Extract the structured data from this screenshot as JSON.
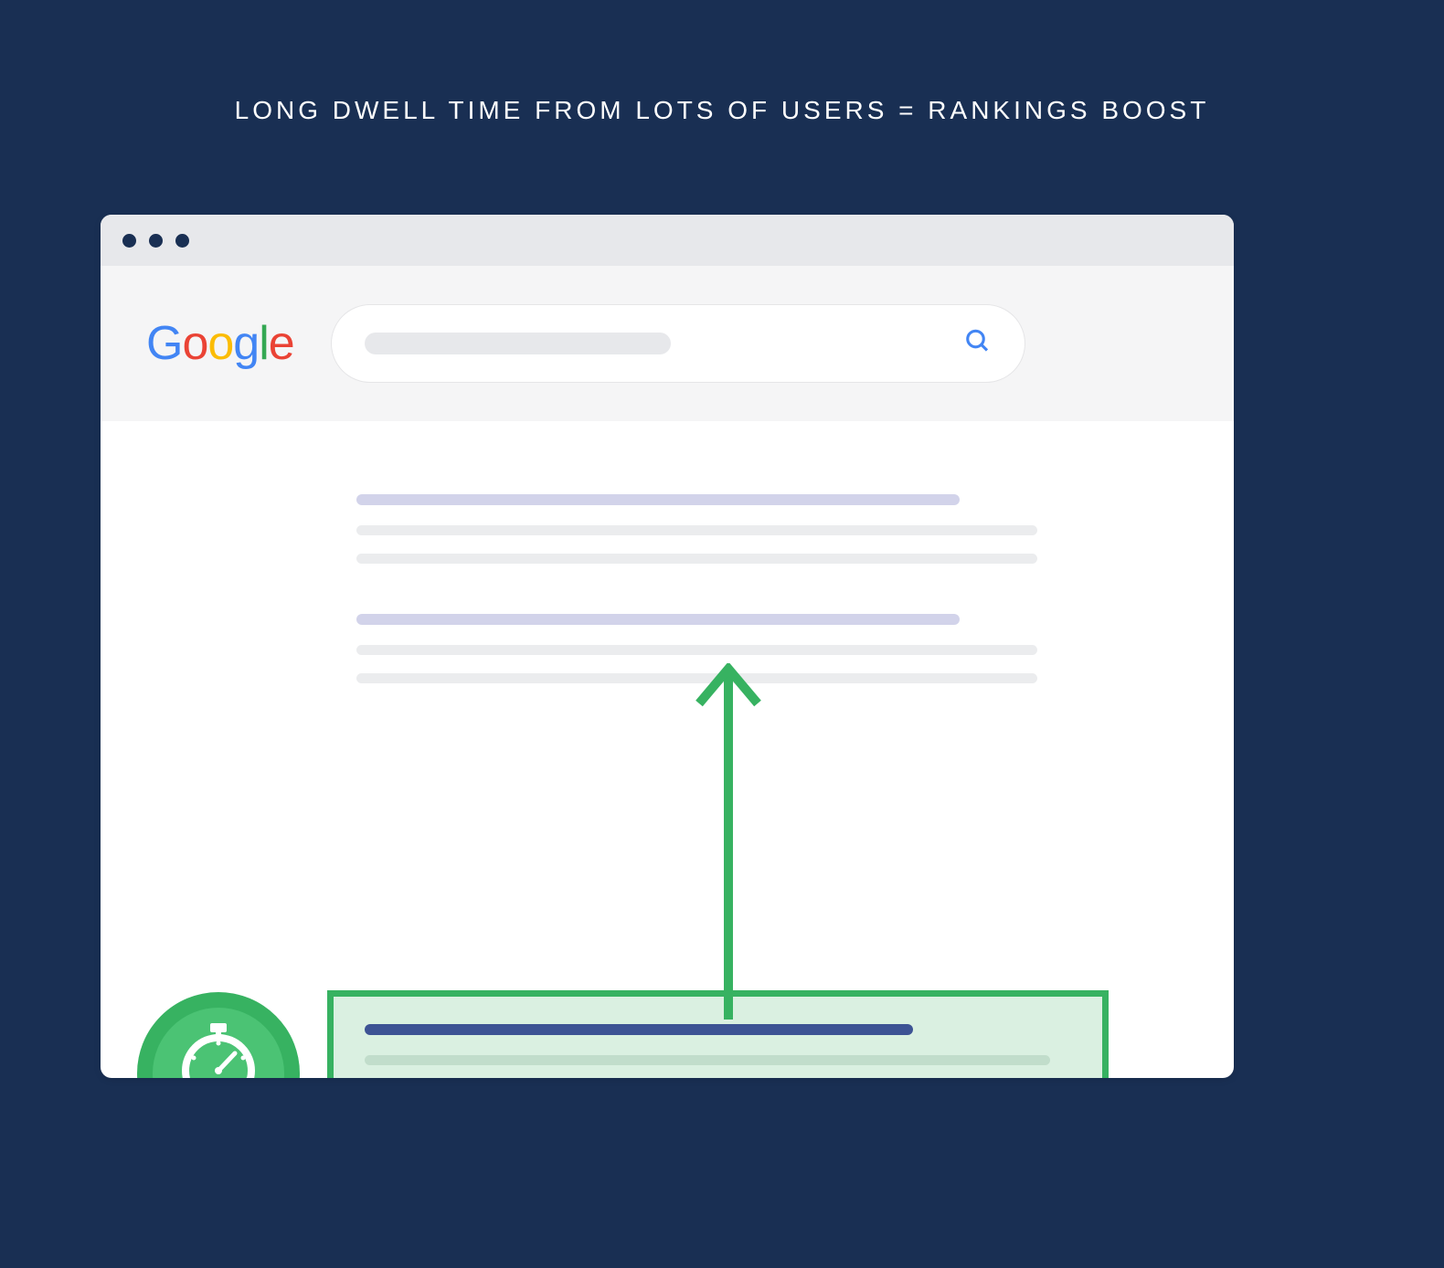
{
  "title": "LONG DWELL TIME FROM LOTS OF USERS = RANKINGS BOOST",
  "logo": {
    "g": "G",
    "o1": "o",
    "o2": "o",
    "g2": "g",
    "l": "l",
    "e": "e"
  },
  "colors": {
    "background": "#192f53",
    "accent_green": "#37b261",
    "light_green": "#daf0e1",
    "title_line": "#d2d3ea",
    "body_line": "#ebecee",
    "hr_title": "#3d5394",
    "hr_body": "#c1ddcb"
  },
  "icons": {
    "badge": "stopwatch-thumbsup-icon",
    "search": "search-icon",
    "arrow": "arrow-up-icon"
  }
}
